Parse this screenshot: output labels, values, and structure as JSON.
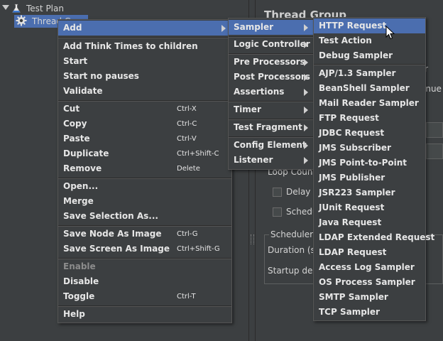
{
  "tree": {
    "items": [
      {
        "label": "Test Plan"
      },
      {
        "label": "Thread G"
      }
    ]
  },
  "right_panel": {
    "title": "Thread Group",
    "loop_count_label": "Loop Count",
    "delay_label": "Delay T",
    "scheduler_check_label": "Schedu",
    "scheduler_group_label": "Scheduler",
    "duration_label": "Duration (se",
    "startup_delay_label": "Startup dela",
    "fragment_r": "r",
    "fragment_inue": "inue"
  },
  "context_menu": {
    "items": [
      {
        "label": "Add",
        "submenu": true,
        "highlighted": true
      },
      {
        "label": "Add Think Times to children"
      },
      {
        "label": "Start"
      },
      {
        "label": "Start no pauses"
      },
      {
        "label": "Validate"
      },
      {
        "label": "Cut",
        "shortcut": "Ctrl-X"
      },
      {
        "label": "Copy",
        "shortcut": "Ctrl-C"
      },
      {
        "label": "Paste",
        "shortcut": "Ctrl-V"
      },
      {
        "label": "Duplicate",
        "shortcut": "Ctrl+Shift-C"
      },
      {
        "label": "Remove",
        "shortcut": "Delete"
      },
      {
        "label": "Open..."
      },
      {
        "label": "Merge"
      },
      {
        "label": "Save Selection As..."
      },
      {
        "label": "Save Node As Image",
        "shortcut": "Ctrl-G"
      },
      {
        "label": "Save Screen As Image",
        "shortcut": "Ctrl+Shift-G"
      },
      {
        "label": "Enable",
        "disabled": true
      },
      {
        "label": "Disable"
      },
      {
        "label": "Toggle",
        "shortcut": "Ctrl-T"
      },
      {
        "label": "Help"
      }
    ]
  },
  "add_submenu": {
    "items": [
      {
        "label": "Sampler",
        "highlighted": true
      },
      {
        "label": "Logic Controller"
      },
      {
        "label": "Pre Processors"
      },
      {
        "label": "Post Processors"
      },
      {
        "label": "Assertions"
      },
      {
        "label": "Timer"
      },
      {
        "label": "Test Fragment"
      },
      {
        "label": "Config Element"
      },
      {
        "label": "Listener"
      }
    ]
  },
  "sampler_submenu": {
    "items": [
      {
        "label": "HTTP Request",
        "highlighted": true
      },
      {
        "label": "Test Action"
      },
      {
        "label": "Debug Sampler"
      },
      {
        "label": "AJP/1.3 Sampler"
      },
      {
        "label": "BeanShell Sampler"
      },
      {
        "label": "Mail Reader Sampler"
      },
      {
        "label": "FTP Request"
      },
      {
        "label": "JDBC Request"
      },
      {
        "label": "JMS Subscriber"
      },
      {
        "label": "JMS Point-to-Point"
      },
      {
        "label": "JMS Publisher"
      },
      {
        "label": "JSR223 Sampler"
      },
      {
        "label": "JUnit Request"
      },
      {
        "label": "Java Request"
      },
      {
        "label": "LDAP Extended Request"
      },
      {
        "label": "LDAP Request"
      },
      {
        "label": "Access Log Sampler"
      },
      {
        "label": "OS Process Sampler"
      },
      {
        "label": "SMTP Sampler"
      },
      {
        "label": "TCP Sampler"
      }
    ]
  },
  "colors": {
    "highlight": "#4b6eaf",
    "background": "#3c3f41"
  }
}
